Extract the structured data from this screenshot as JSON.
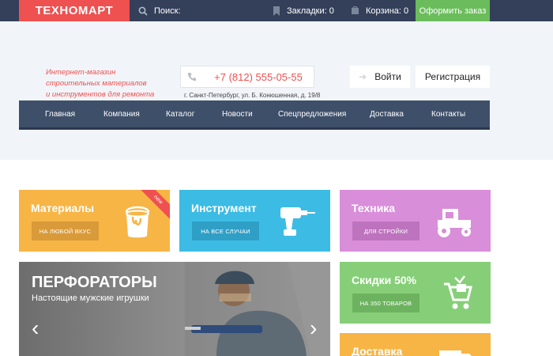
{
  "topbar": {
    "logo": "ТЕХНОМАРТ",
    "search_label": "Поиск:",
    "bookmarks": "Закладки: 0",
    "cart": "Корзина: 0",
    "order_button": "Оформить заказ"
  },
  "header": {
    "tagline": [
      "Интернет-магазин",
      "строительных материалов",
      "и инструментов для ремонта"
    ],
    "phone": "+7 (812) 555-05-55",
    "address": "г. Санкт-Петербург, ул. Б. Конюшенная, д. 19/8",
    "login": "Войти",
    "register": "Регистрация"
  },
  "nav": {
    "items": [
      "Главная",
      "Компания",
      "Каталог",
      "Новости",
      "Спецпредложения",
      "Доставка",
      "Контакты"
    ]
  },
  "tiles": [
    {
      "title": "Материалы",
      "button": "НА ЛЮБОЙ ВКУС",
      "ribbon": "new",
      "color": "#f7b546",
      "icon": "paint-bucket-icon"
    },
    {
      "title": "Инструмент",
      "button": "НА ВСЕ СЛУЧАИ",
      "color": "#3cbce4",
      "icon": "drill-icon"
    },
    {
      "title": "Техника",
      "button": "ДЛЯ СТРОЙКИ",
      "color": "#d98ed9",
      "icon": "tractor-icon"
    },
    {
      "title": "Скидки 50%",
      "button": "НА 350 ТОВАРОВ",
      "color": "#86cf78",
      "icon": "cart-icon"
    },
    {
      "title": "Доставка",
      "color": "#f7b546",
      "icon": "truck-icon"
    }
  ],
  "banner": {
    "title": "ПЕРФОРАТОРЫ",
    "subtitle": "Настоящие мужские игрушки"
  },
  "colors": {
    "topbar": "#34405a",
    "accent_red": "#ef5050",
    "order_green": "#6bbd5b",
    "nav": "#3e4f69"
  }
}
